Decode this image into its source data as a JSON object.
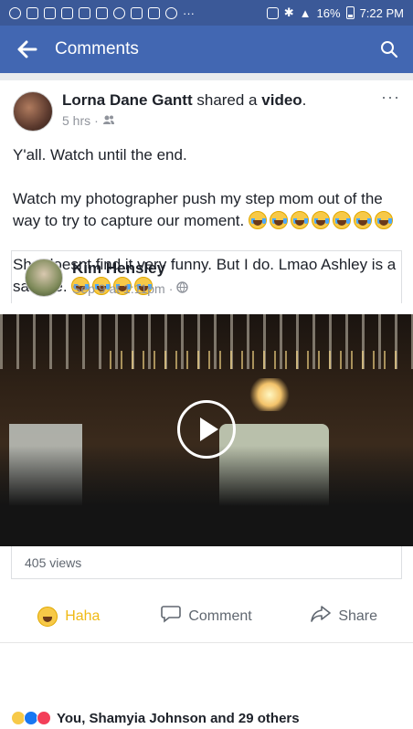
{
  "status_bar": {
    "battery": "16%",
    "time": "7:22 PM"
  },
  "app_bar": {
    "title": "Comments"
  },
  "post": {
    "author": "Lorna Dane Gantt",
    "action_text": "shared a",
    "action_object": "video",
    "timestamp": "5 hrs",
    "paragraph1": "Y'all. Watch until the end.",
    "paragraph2": "Watch my photographer push my step mom out of the way to try to capture our moment.",
    "paragraph3": "She doesnt find it very funny. But I do. Lmao Ashley is a savage."
  },
  "shared": {
    "author": "Kim Hensley",
    "timestamp": "Sep 9 at 1:11pm",
    "views": "405 views"
  },
  "actions": {
    "haha": "Haha",
    "comment": "Comment",
    "share": "Share"
  },
  "reactions": {
    "summary": "You, Shamyia Johnson and 29 others"
  }
}
